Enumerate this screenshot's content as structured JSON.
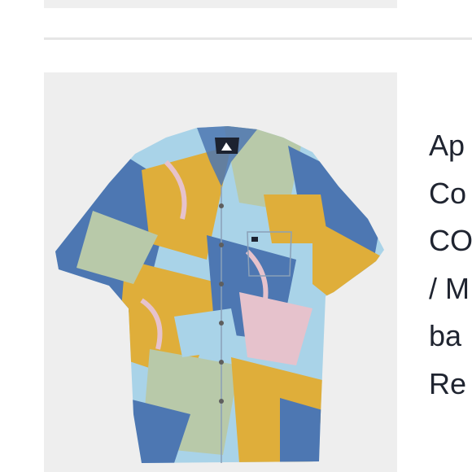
{
  "product": {
    "image_alt": "Short sleeve button-up shirt with tropical leaf print",
    "palette": {
      "background": "#eeeeee",
      "blue": "#4d77b2",
      "light_blue": "#a9d3e8",
      "mustard": "#dfae3a",
      "sage": "#b8c9a9",
      "pink": "#e6c2cc"
    }
  },
  "details_lines": [
    "Ap",
    "Co",
    "CO",
    "/ M",
    "ba",
    "Re"
  ]
}
